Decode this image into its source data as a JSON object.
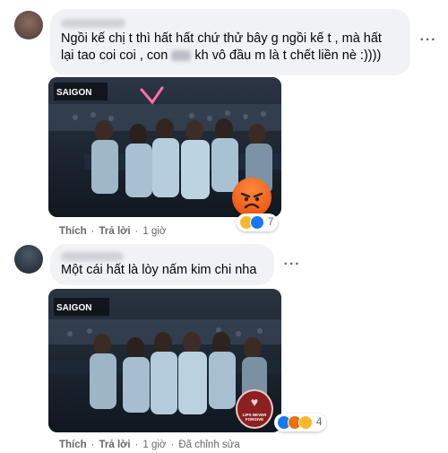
{
  "comment1": {
    "text_line1": "Ngồi kế chị t thì hất hất chứ thử bây g ngồi kế t , mà hất",
    "text_line2_a": "lại tao coi coi , con",
    "text_line2_b": "kh vô đầu m là t chết liền nè :))))",
    "more_label": "···",
    "actions": {
      "like": "Thích",
      "reply": "Trả lời",
      "time": "1 giờ"
    },
    "reactions": {
      "count": "7",
      "icons": [
        "haha-icon",
        "like-icon",
        "angry-icon"
      ]
    },
    "photo": {
      "logo": "SAIGON"
    }
  },
  "comment2": {
    "text": "Một cái hất là lòy nấm kim chi nha",
    "more_label": "···",
    "actions": {
      "like": "Thích",
      "reply": "Trả lời",
      "time": "1 giờ",
      "edited": "Đã chỉnh sửa"
    },
    "reactions": {
      "count": "4",
      "icons": [
        "like-icon",
        "angry-icon",
        "haha-icon"
      ]
    },
    "photo": {
      "logo": "SAIGON",
      "badge": "LIPS NEVER FORGIVE"
    }
  },
  "colors": {
    "like": "#1877f2",
    "haha": "#f7b928",
    "angry": "#e9710f",
    "text_secondary": "#65676b",
    "bubble": "#f0f2f5"
  }
}
